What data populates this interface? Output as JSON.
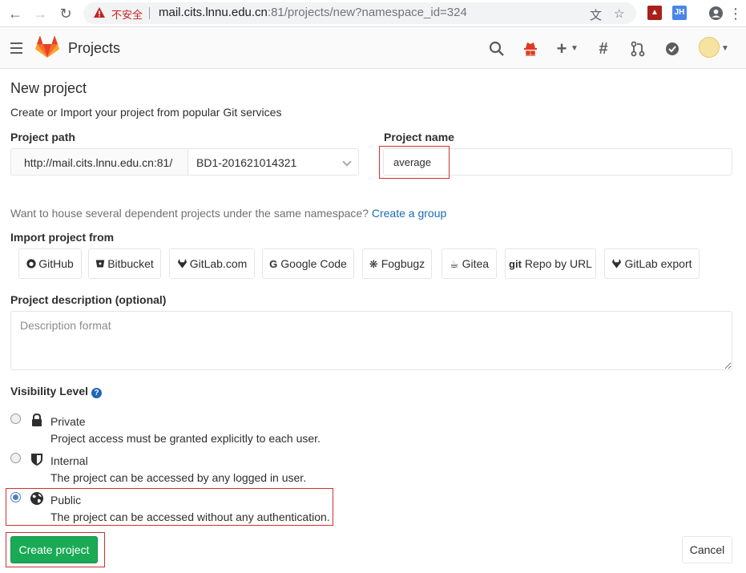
{
  "browser": {
    "insecure_label": "不安全",
    "url_host": "mail.cits.lnnu.edu.cn",
    "url_rest": ":81/projects/new?namespace_id=324",
    "ext_jh": "JH"
  },
  "header": {
    "title": "Projects"
  },
  "page": {
    "heading": "New project",
    "subtitle": "Create or Import your project from popular Git services"
  },
  "form": {
    "project_path_label": "Project path",
    "path_prefix": "http://mail.cits.lnnu.edu.cn:81/",
    "namespace_value": "BD1-201621014321",
    "project_name_label": "Project name",
    "project_name_value": "average",
    "house_text": "Want to house several dependent projects under the same namespace?",
    "create_group_link": "Create a group",
    "import_label": "Import project from",
    "import_sources": [
      "GitHub",
      "Bitbucket",
      "GitLab.com",
      "Google Code",
      "Fogbugz",
      "Gitea",
      "Repo by URL",
      "GitLab export"
    ],
    "import_icon_git": "git",
    "import_icon_google": "G",
    "description_label": "Project description (optional)",
    "description_placeholder": "Description format",
    "visibility_label": "Visibility Level",
    "visibility": [
      {
        "title": "Private",
        "desc": "Project access must be granted explicitly to each user."
      },
      {
        "title": "Internal",
        "desc": "The project can be accessed by any logged in user."
      },
      {
        "title": "Public",
        "desc": "The project can be accessed without any authentication."
      }
    ],
    "selected_visibility": "Public",
    "create_button": "Create project",
    "cancel_button": "Cancel"
  },
  "colors": {
    "accent_green": "#1aaa55",
    "link_blue": "#1b69b6",
    "highlight_red": "#d0312d"
  }
}
